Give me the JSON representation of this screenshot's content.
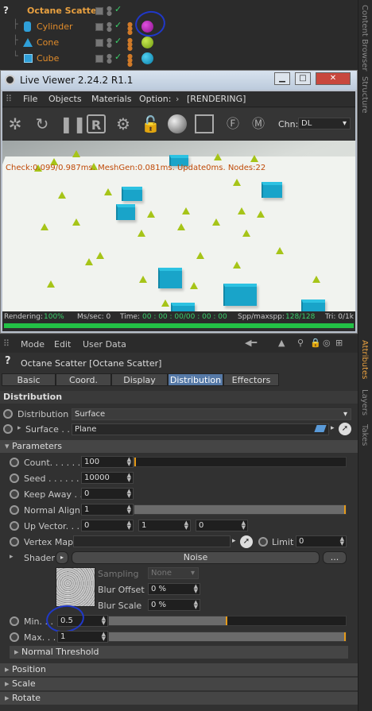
{
  "tree": {
    "header": {
      "label": "Octane Scatter",
      "icon": "question-icon"
    },
    "items": [
      {
        "label": "Cylinder",
        "icon": "cylinder-icon"
      },
      {
        "label": "Cone",
        "icon": "cone-icon"
      },
      {
        "label": "Cube",
        "icon": "cube-icon"
      }
    ]
  },
  "sidebar": [
    "Content Browser",
    "Structure",
    "Attributes",
    "Layers",
    "Takes"
  ],
  "live_viewer": {
    "title": "Live Viewer 2.24.2 R1.1",
    "menu": [
      "File",
      "Objects",
      "Materials",
      "Option:",
      "[RENDERING]"
    ],
    "chn_label": "Chn:",
    "chn_value": "DL",
    "stats": "Check:0.099/0.987ms. MeshGen:0.081ms. Update0ms. Nodes:22",
    "status": {
      "rendering": "Rendering:",
      "rendering_val": "100%",
      "ms_sec": "Ms/sec: 0",
      "time": "Time:",
      "time_val": "00 : 00 : 00/00 : 00 : 00",
      "spp": "Spp/maxspp:",
      "spp_val": "128/128",
      "tri": "Tri: 0/1k"
    },
    "progress": 1.0
  },
  "attr": {
    "menu": [
      "Mode",
      "Edit",
      "User Data"
    ],
    "title": "Octane Scatter [Octane Scatter]",
    "tabs": [
      "Basic",
      "Coord.",
      "Display",
      "Distribution",
      "Effectors"
    ],
    "active_tab": "Distribution",
    "section": "Distribution",
    "distribution_label": "Distribution",
    "distribution_value": "Surface",
    "surface_label": "Surface . .",
    "surface_value": "Plane",
    "parameters": "Parameters",
    "count_label": "Count. . . . . .",
    "count_value": "100",
    "seed_label": "Seed . . . . . .",
    "seed_value": "10000",
    "keepaway_label": "Keep Away . .",
    "keepaway_value": "0",
    "normalalign_label": "Normal Align",
    "normalalign_value": "1",
    "upvector_label": "Up Vector. . .",
    "upvector_values": [
      "0",
      "1",
      "0"
    ],
    "vertexmap_label": "Vertex Map",
    "limit_label": "Limit",
    "limit_value": "0",
    "shader_label": "Shader",
    "shader_value": "Noise",
    "shader_more": "...",
    "sampling_label": "Sampling",
    "sampling_value": "None",
    "bluroffset_label": "Blur Offset",
    "bluroffset_value": "0 %",
    "blurscale_label": "Blur Scale",
    "blurscale_value": "0 %",
    "min_label": "Min. . .",
    "min_value": "0.5",
    "max_label": "Max. . .",
    "max_value": "1",
    "normal_threshold": "Normal Threshold",
    "position": "Position",
    "scale": "Scale",
    "rotate": "Rotate"
  },
  "colors": {
    "accent": "#e59a18",
    "active_tab": "#5679a6",
    "progress": "#22c246",
    "cube": "#19a4c9",
    "cone": "#a6c418"
  }
}
